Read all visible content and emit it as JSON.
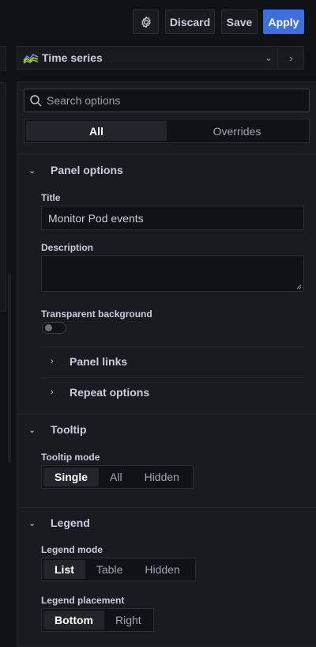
{
  "toolbar": {
    "settings_icon": "gear-icon",
    "discard_label": "Discard",
    "save_label": "Save",
    "apply_label": "Apply",
    "accent_color": "#3d71d9"
  },
  "visualization": {
    "icon": "time-series-icon",
    "label": "Time series"
  },
  "options": {
    "search": {
      "placeholder": "Search options",
      "value": ""
    },
    "tabs": [
      {
        "label": "All",
        "active": true
      },
      {
        "label": "Overrides",
        "active": false
      }
    ],
    "panel_options": {
      "title": "Panel options",
      "title_label": "Title",
      "title_value": "Monitor Pod events",
      "description_label": "Description",
      "description_value": "",
      "transparent_label": "Transparent background",
      "transparent_value": false,
      "panel_links_label": "Panel links",
      "repeat_options_label": "Repeat options"
    },
    "tooltip": {
      "title": "Tooltip",
      "mode_label": "Tooltip mode",
      "modes": [
        "Single",
        "All",
        "Hidden"
      ],
      "selected": "Single"
    },
    "legend": {
      "title": "Legend",
      "mode_label": "Legend mode",
      "modes": [
        "List",
        "Table",
        "Hidden"
      ],
      "selected_mode": "List",
      "placement_label": "Legend placement",
      "placements": [
        "Bottom",
        "Right"
      ],
      "selected_placement": "Bottom"
    }
  }
}
